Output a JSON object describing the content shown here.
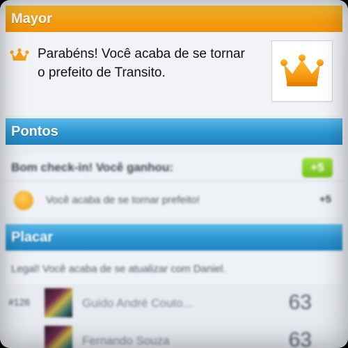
{
  "mayor": {
    "header": "Mayor",
    "message": "Parabéns! Você acaba de se tornar o prefeito de Transito."
  },
  "pontos": {
    "header": "Pontos",
    "checkin_title": "Bom check-in! Você ganhou:",
    "total_badge": "+5",
    "items": [
      {
        "text": "Você acaba de se tornar prefeito!",
        "value": "+5"
      }
    ]
  },
  "placar": {
    "header": "Placar",
    "message": "Legal! Você acaba de se atualizar com Daniel.",
    "rows": [
      {
        "rank": "#126",
        "name": "Guido André Couto...",
        "score": "63"
      },
      {
        "rank": "",
        "name": "Fernando Souza",
        "score": "63"
      }
    ]
  },
  "colors": {
    "mayor_bar": "#f7a012",
    "section_bar": "#2d96d1",
    "points_badge": "#74c21d"
  },
  "icons": {
    "mayor_small": "crown-icon",
    "mayor_badge": "crown-icon",
    "points_row": "coin-icon"
  }
}
